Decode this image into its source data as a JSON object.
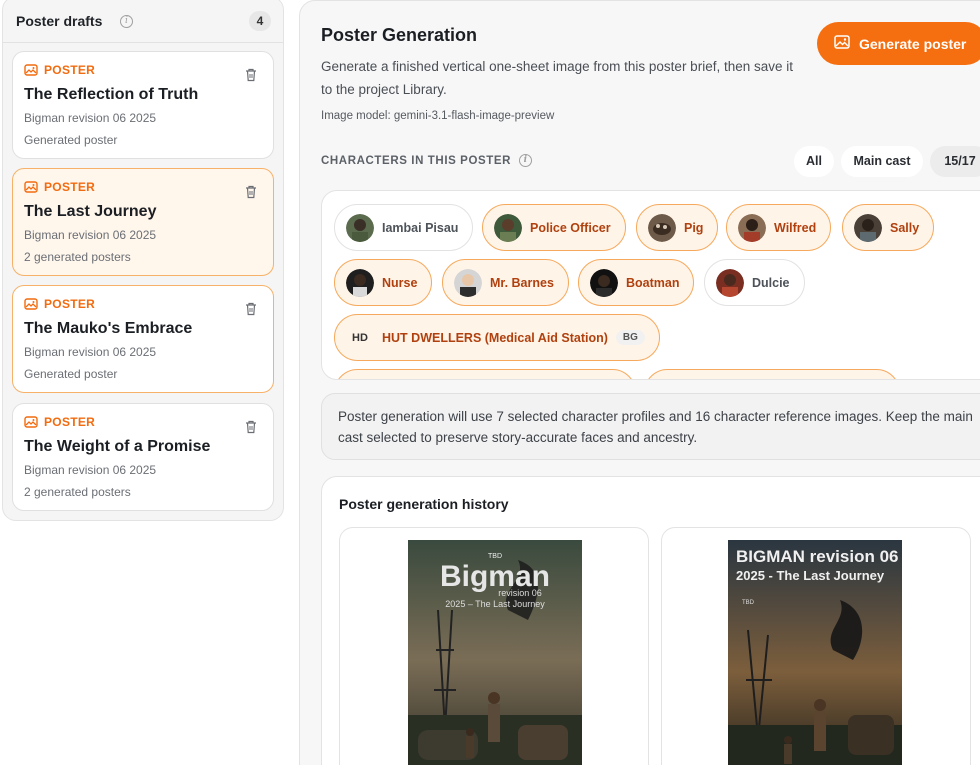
{
  "sidebar": {
    "title": "Poster drafts",
    "count": "4",
    "cards": [
      {
        "tag": "POSTER",
        "title": "The Reflection of Truth",
        "subtitle": "Bigman revision 06 2025",
        "status": "Generated poster"
      },
      {
        "tag": "POSTER",
        "title": "The Last Journey",
        "subtitle": "Bigman revision 06 2025",
        "status": "2 generated posters"
      },
      {
        "tag": "POSTER",
        "title": "The Mauko's Embrace",
        "subtitle": "Bigman revision 06 2025",
        "status": "Generated poster"
      },
      {
        "tag": "POSTER",
        "title": "The Weight of a Promise",
        "subtitle": "Bigman revision 06 2025",
        "status": "2 generated posters"
      }
    ]
  },
  "main": {
    "title": "Poster Generation",
    "description": "Generate a finished vertical one-sheet image from this poster brief, then save it to the project Library.",
    "model_line": "Image model: gemini-3.1-flash-image-preview",
    "generate_label": "Generate poster",
    "characters_label": "CHARACTERS IN THIS POSTER",
    "filters": {
      "all": "All",
      "main_cast": "Main cast",
      "count": "15/17"
    },
    "characters": [
      {
        "name": "Iambai Pisau",
        "selected": false
      },
      {
        "name": "Police Officer",
        "selected": true
      },
      {
        "name": "Pig",
        "selected": true
      },
      {
        "name": "Wilfred",
        "selected": true
      },
      {
        "name": "Sally",
        "selected": true
      },
      {
        "name": "Nurse",
        "selected": true
      },
      {
        "name": "Mr. Barnes",
        "selected": true
      },
      {
        "name": "Boatman",
        "selected": true
      },
      {
        "name": "Dulcie",
        "selected": false
      },
      {
        "name": "HUT DWELLERS (Medical Aid Station)",
        "selected": true,
        "initials": "HD",
        "badge": "BG"
      }
    ],
    "notice": "Poster generation will use 7 selected character profiles and 16 character reference images. Keep the main cast selected to preserve story-accurate faces and ancestry.",
    "history_title": "Poster generation history",
    "posters": [
      {
        "small_top": "TBD",
        "title": "Bigman",
        "line2": "revision 06",
        "line3": "2025 – The Last Journey"
      },
      {
        "title": "BIGMAN revision 06",
        "line2": "2025 - The Last Journey",
        "small_top": "TBD"
      }
    ]
  },
  "colors": {
    "accent": "#f56e0f",
    "accent_text": "#b0410f",
    "chip_selected_bg": "#fff4e8",
    "chip_selected_border": "#f6a95c"
  },
  "icons": {
    "info": "info-icon",
    "image": "image-icon",
    "trash": "trash-icon"
  }
}
